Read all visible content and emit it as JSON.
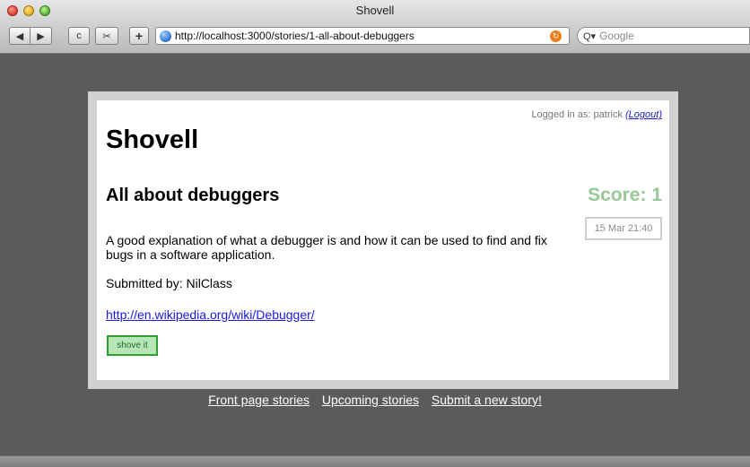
{
  "window": {
    "title": "Shovell",
    "url": "http://localhost:3000/stories/1-all-about-debuggers",
    "search_placeholder": "Google"
  },
  "toolbar": {
    "back_icon": "◀",
    "forward_icon": "▶",
    "reload_icon": "c",
    "snip_icon": "✂",
    "add_icon": "+",
    "rss_icon": "↻",
    "search_icon": "Q▾"
  },
  "header": {
    "logged_in_text": "Logged in as: patrick",
    "logout_label": "(Logout)",
    "site_title": "Shovell"
  },
  "story": {
    "title": "All about debuggers",
    "score": "Score: 1",
    "date": "15 Mar 21:40",
    "description": "A good explanation of what a debugger is and how it can be used to find and fix bugs in a software application.",
    "submitted_by": "Submitted by: NilClass",
    "link": "http://en.wikipedia.org/wiki/Debugger/",
    "shove_label": "shove it"
  },
  "footer": {
    "links": [
      "Front page stories",
      "Upcoming stories",
      "Submit a new story!"
    ]
  },
  "colors": {
    "score": "#96c896",
    "shove_border": "#2fa02f",
    "link": "#1a1ae0"
  }
}
